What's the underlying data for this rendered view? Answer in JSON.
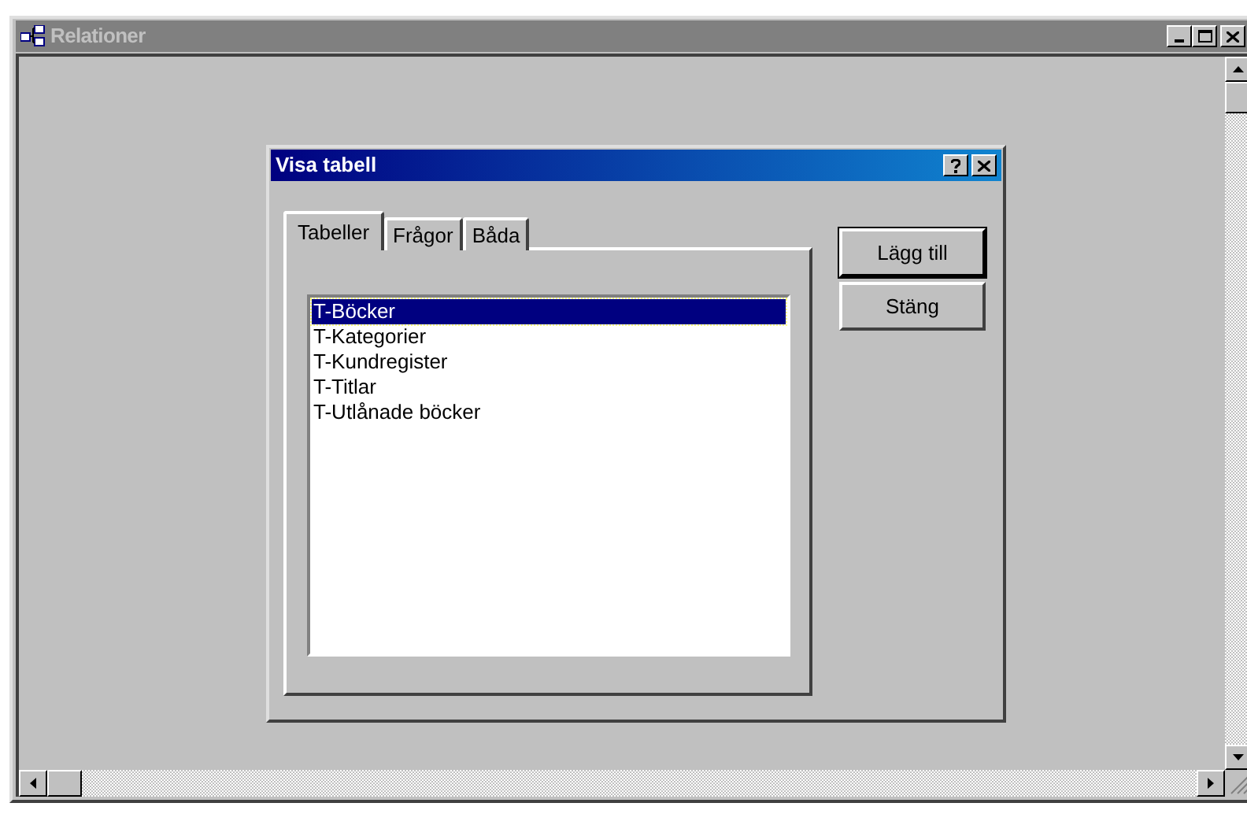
{
  "window": {
    "title": "Relationer",
    "active": false
  },
  "dialog": {
    "title": "Visa tabell",
    "tabs": [
      {
        "label": "Tabeller",
        "selected": true
      },
      {
        "label": "Frågor",
        "selected": false
      },
      {
        "label": "Båda",
        "selected": false
      }
    ],
    "list": [
      {
        "label": "T-Böcker",
        "selected": true
      },
      {
        "label": "T-Kategorier",
        "selected": false
      },
      {
        "label": "T-Kundregister",
        "selected": false
      },
      {
        "label": "T-Titlar",
        "selected": false
      },
      {
        "label": "T-Utlånade böcker",
        "selected": false
      }
    ],
    "buttons": [
      {
        "label": "Lägg till",
        "default": true
      },
      {
        "label": "Stäng",
        "default": false
      }
    ]
  }
}
